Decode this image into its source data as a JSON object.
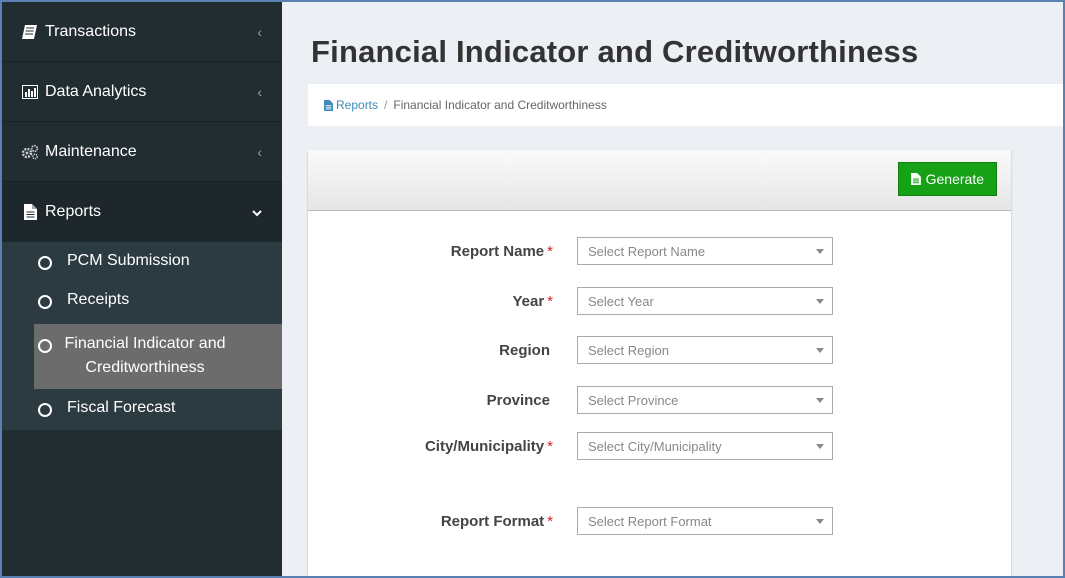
{
  "sidebar": {
    "items": [
      {
        "label": "Transactions",
        "icon": "book-icon"
      },
      {
        "label": "Data Analytics",
        "icon": "bar-chart-icon"
      },
      {
        "label": "Maintenance",
        "icon": "cogs-icon"
      },
      {
        "label": "Reports",
        "icon": "file-icon"
      }
    ],
    "submenu": [
      {
        "label": "PCM Submission"
      },
      {
        "label": "Receipts"
      },
      {
        "label": "Financial Indicator and Creditworthiness"
      },
      {
        "label": "Fiscal Forecast"
      }
    ]
  },
  "page": {
    "title": "Financial Indicator and Creditworthiness",
    "breadcrumb": {
      "root": "Reports",
      "sep": "/",
      "current": "Financial Indicator and Creditworthiness"
    }
  },
  "toolbar": {
    "generate_label": "Generate"
  },
  "form": {
    "fields": [
      {
        "label": "Report Name",
        "required": "*",
        "placeholder": "Select Report Name"
      },
      {
        "label": "Year",
        "required": "*",
        "placeholder": "Select Year"
      },
      {
        "label": "Region",
        "required": "",
        "placeholder": "Select Region"
      },
      {
        "label": "Province",
        "required": "",
        "placeholder": "Select Province"
      },
      {
        "label": "City/Municipality",
        "required": "*",
        "placeholder": "Select City/Municipality"
      },
      {
        "label": "Report Format",
        "required": "*",
        "placeholder": "Select Report Format"
      }
    ]
  },
  "colors": {
    "sidebar_bg": "#222d32",
    "link": "#3c8dbc",
    "generate_bg": "#16a116",
    "required": "#dd2222"
  }
}
